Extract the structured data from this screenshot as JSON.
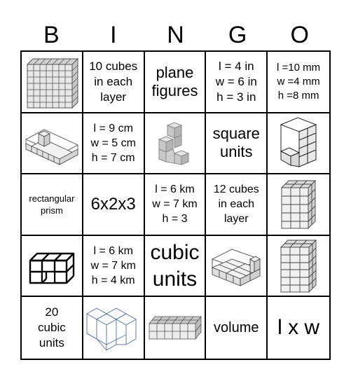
{
  "header": {
    "letters": [
      "B",
      "I",
      "N",
      "G",
      "O"
    ]
  },
  "cells": [
    {
      "type": "image",
      "icon": "cube-grid-wall-icon"
    },
    {
      "type": "text",
      "text": "10 cubes\nin each\nlayer"
    },
    {
      "type": "text",
      "text": "plane\nfigures"
    },
    {
      "type": "text",
      "text": "l = 4 in\nw = 6 in\nh = 3 in"
    },
    {
      "type": "text",
      "text": "l =10 mm\nw =4 mm\nh =8 mm"
    },
    {
      "type": "image",
      "icon": "open-box-cubes-icon"
    },
    {
      "type": "text",
      "text": "l = 9 cm\nw = 5 cm\nh = 7 cm"
    },
    {
      "type": "image",
      "icon": "stacked-cubes-icon"
    },
    {
      "type": "text",
      "text": "square\nunits"
    },
    {
      "type": "image",
      "icon": "l-shaped-cubes-icon"
    },
    {
      "type": "text",
      "text": "rectangular\nprism"
    },
    {
      "type": "text",
      "text": "6x2x3"
    },
    {
      "type": "text",
      "text": "l = 6 km\nw = 7 km\nh = 3"
    },
    {
      "type": "text",
      "text": "12 cubes\nin each\nlayer"
    },
    {
      "type": "image",
      "icon": "tall-cube-prism-icon"
    },
    {
      "type": "image",
      "icon": "outlined-cubes-icon"
    },
    {
      "type": "text",
      "text": "l = 6 km\nw = 7 km\nh = 4 km"
    },
    {
      "type": "text",
      "text": "cubic\nunits"
    },
    {
      "type": "image",
      "icon": "partial-box-cubes-icon"
    },
    {
      "type": "image",
      "icon": "tall-grid-prism-icon"
    },
    {
      "type": "text",
      "text": "20\ncubic\nunits"
    },
    {
      "type": "image",
      "icon": "blue-wireframe-cubes-icon"
    },
    {
      "type": "image",
      "icon": "flat-cube-slab-icon"
    },
    {
      "type": "text",
      "text": "volume"
    },
    {
      "type": "text",
      "text": "l x w"
    }
  ]
}
